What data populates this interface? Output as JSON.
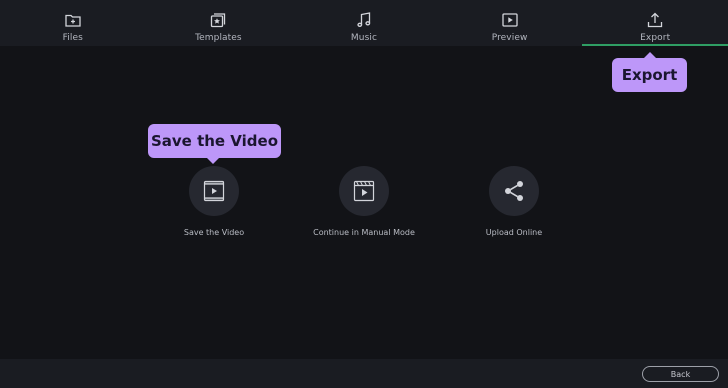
{
  "tabs": [
    {
      "label": "Files",
      "icon": "folder-plus-icon"
    },
    {
      "label": "Templates",
      "icon": "templates-star-icon"
    },
    {
      "label": "Music",
      "icon": "music-note-icon"
    },
    {
      "label": "Preview",
      "icon": "play-preview-icon"
    },
    {
      "label": "Export",
      "icon": "export-upload-icon",
      "active": true
    }
  ],
  "callouts": {
    "export": "Export",
    "save": "Save the Video"
  },
  "options": [
    {
      "label": "Save the Video",
      "icon": "film-play-icon"
    },
    {
      "label": "Continue in Manual Mode",
      "icon": "clapperboard-play-icon"
    },
    {
      "label": "Upload Online",
      "icon": "share-icon"
    }
  ],
  "footer": {
    "back_label": "Back"
  },
  "colors": {
    "accent_tooltip": "#bd97f9",
    "active_tab_underline": "#2f9e64",
    "background": "#121317",
    "bar": "#1a1c22"
  }
}
